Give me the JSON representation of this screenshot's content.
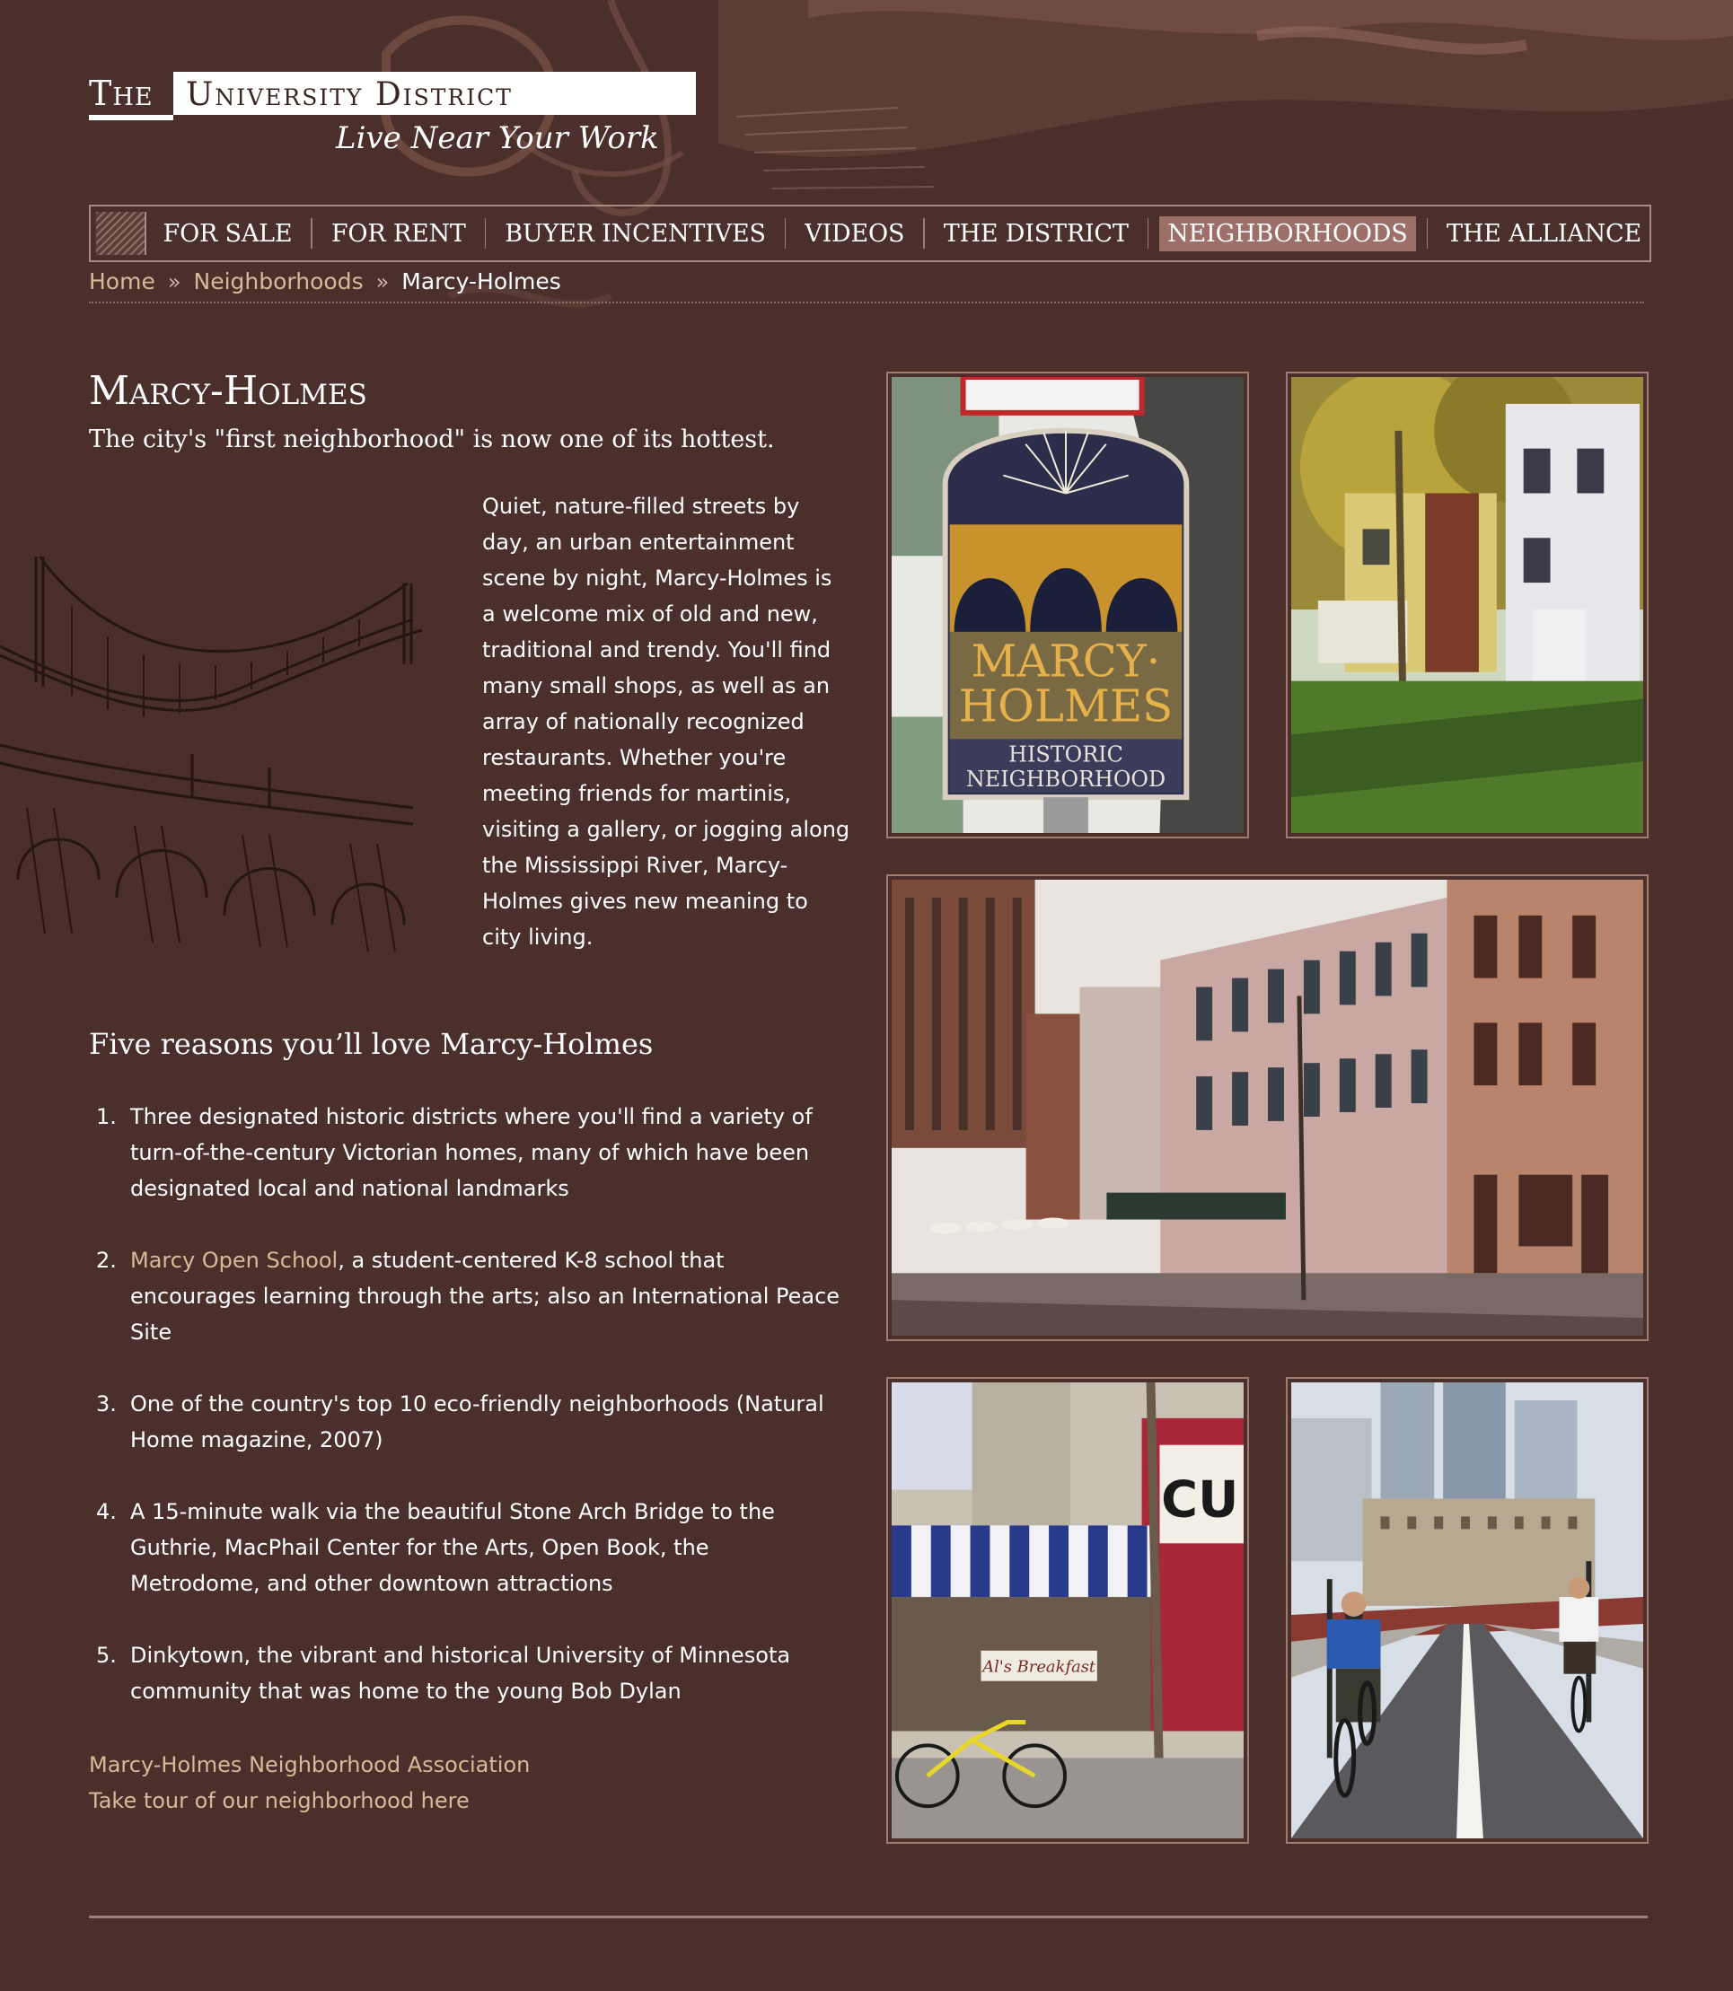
{
  "logo": {
    "the": "The",
    "name": "University District",
    "tagline": "Live Near Your Work"
  },
  "nav": {
    "items": [
      {
        "label": "FOR SALE",
        "active": false
      },
      {
        "label": "FOR RENT",
        "active": false
      },
      {
        "label": "BUYER INCENTIVES",
        "active": false
      },
      {
        "label": "VIDEOS",
        "active": false
      },
      {
        "label": "THE DISTRICT",
        "active": false
      },
      {
        "label": "NEIGHBORHOODS",
        "active": true
      },
      {
        "label": "THE ALLIANCE",
        "active": false
      }
    ]
  },
  "breadcrumb": {
    "home": "Home",
    "separator": "»",
    "section": "Neighborhoods",
    "current": "Marcy-Holmes"
  },
  "page": {
    "title": "Marcy-Holmes",
    "subtitle": "The city's \"first neighborhood\" is now one of its hottest.",
    "intro": "Quiet, nature-filled streets by day, an urban entertainment scene by night, Marcy-Holmes is a welcome mix of old and new, traditional and trendy. You'll find many small shops, as well as an array of nationally recognized restaurants. Whether you're meeting friends for martinis, visiting a gallery, or jogging along the Mississippi River, Marcy-Holmes gives new meaning to city living."
  },
  "reasons": {
    "heading": "Five reasons you’ll love Marcy-Holmes",
    "items": [
      {
        "num": "1.",
        "link": "",
        "text": "Three designated historic districts where you'll find a variety of turn-of-the-century Victorian homes, many of which have been designated local and national landmarks"
      },
      {
        "num": "2.",
        "link": "Marcy Open School",
        "text": ", a student-centered K-8 school that encourages learning through the arts; also an International Peace Site"
      },
      {
        "num": "3.",
        "link": "",
        "text": "One of the country's top 10 eco-friendly neighborhoods (Natural Home magazine, 2007)"
      },
      {
        "num": "4.",
        "link": "",
        "text": "A 15-minute walk via the beautiful Stone Arch Bridge to the Guthrie, MacPhail Center for the Arts, Open Book, the Metrodome, and other downtown attractions"
      },
      {
        "num": "5.",
        "link": "",
        "text": "Dinkytown, the vibrant and historical University of Minnesota community that was home to the young Bob Dylan"
      }
    ]
  },
  "links": {
    "association": "Marcy-Holmes Neighborhood Association",
    "tour": "Take tour of our neighborhood here"
  },
  "photos": {
    "sign_line1": "MARCY·",
    "sign_line2": "HOLMES",
    "sign_line3": "HISTORIC",
    "sign_line4": "NEIGHBORHOOD",
    "cafe_sign": "Al's Breakfast",
    "storefront_letters": "CU"
  },
  "colors": {
    "background": "#4a2f2a",
    "link": "#d8b999",
    "nav_active": "#9c7069",
    "frame": "#a07b72"
  }
}
